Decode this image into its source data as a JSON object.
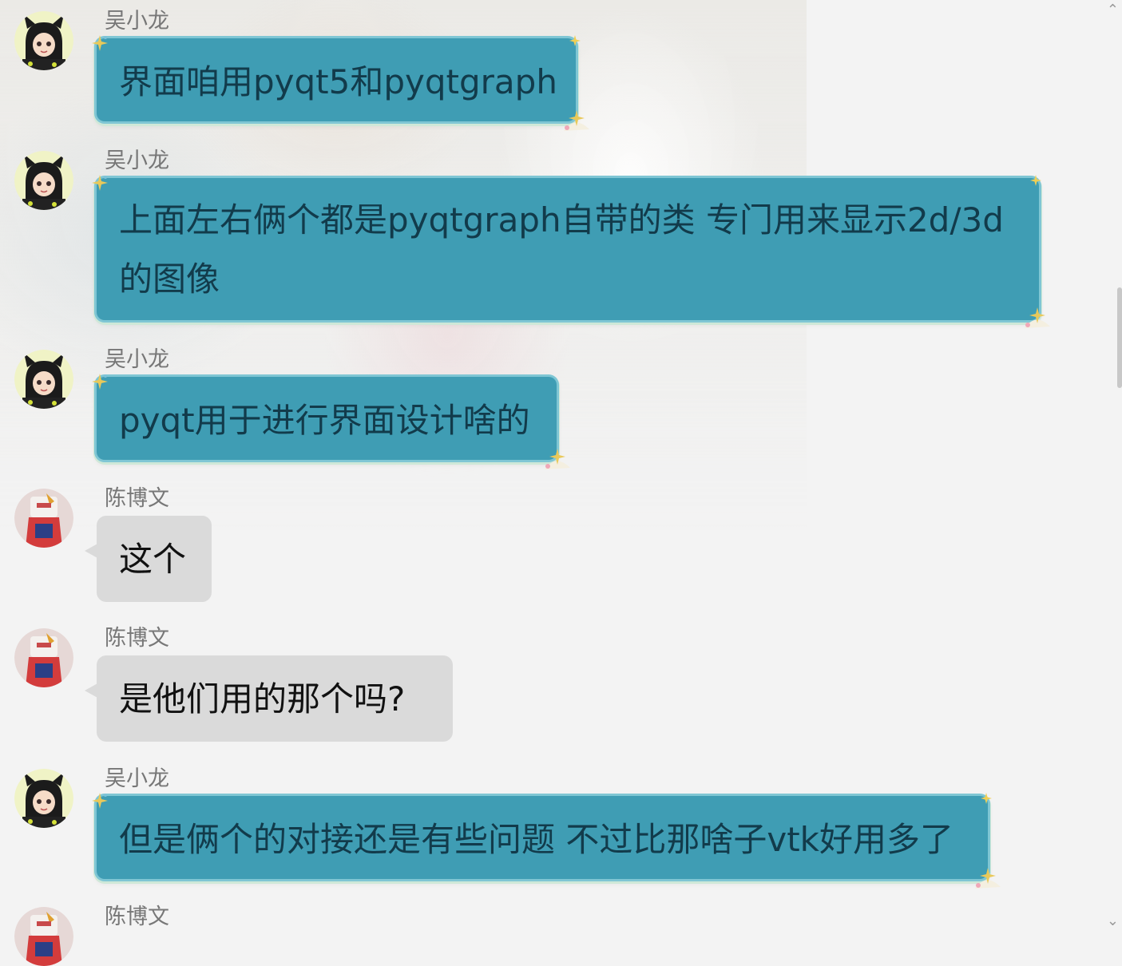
{
  "messages": [
    {
      "sender": "吴小龙",
      "lines": [
        "界面咱用pyqt5和pyqtgraph"
      ],
      "style": "teal",
      "avatar": "cat-girl"
    },
    {
      "sender": "吴小龙",
      "lines": [
        "上面左右俩个都是pyqtgraph自带的类 专门用来显示2d/3d",
        "的图像"
      ],
      "style": "teal",
      "avatar": "cat-girl"
    },
    {
      "sender": "吴小龙",
      "lines": [
        "pyqt用于进行界面设计啥的"
      ],
      "style": "teal",
      "avatar": "cat-girl"
    },
    {
      "sender": "陈博文",
      "lines": [
        "这个"
      ],
      "style": "gray",
      "avatar": "robot-figure"
    },
    {
      "sender": "陈博文",
      "lines": [
        "是他们用的那个吗?"
      ],
      "style": "gray",
      "avatar": "robot-figure"
    },
    {
      "sender": "吴小龙",
      "lines": [
        "但是俩个的对接还是有些问题 不过比那啥子vtk好用多了"
      ],
      "style": "teal",
      "avatar": "cat-girl"
    },
    {
      "sender": "陈博文",
      "lines": [],
      "style": "gray",
      "avatar": "robot-figure"
    }
  ],
  "icons": {
    "avatar_a": "cat-girl-avatar-icon",
    "avatar_b": "robot-figure-avatar-icon",
    "bubble_decoration": "star-sparkle-icon"
  },
  "colors": {
    "teal_bubble": "#3f9db4",
    "teal_text": "#123b4b",
    "gray_bubble": "#dadada",
    "background": "#f3f3f3",
    "sender_text": "#777777"
  }
}
